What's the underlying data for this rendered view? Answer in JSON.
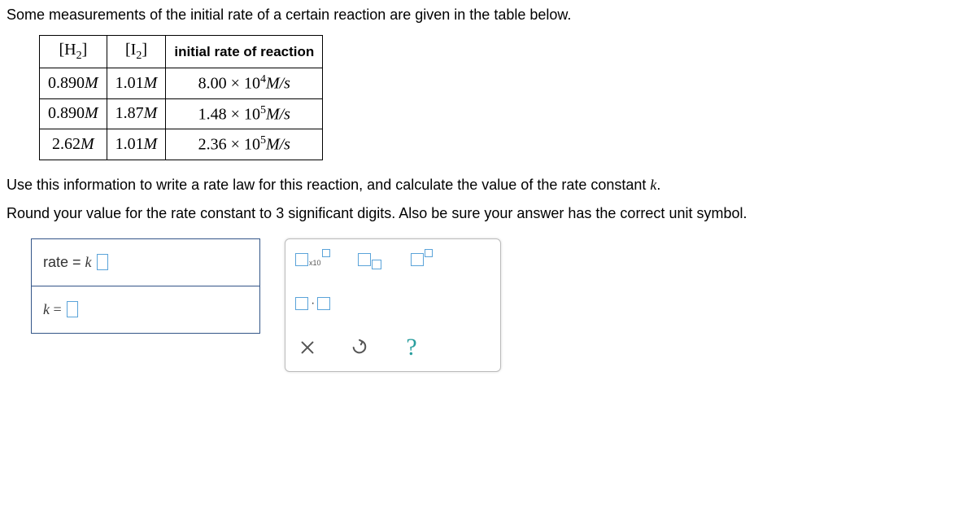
{
  "prompt": {
    "line1": "Some measurements of the initial rate of a certain reaction are given in the table below.",
    "line2_prefix": "Use this information to write a rate law for this reaction, and calculate the value of the rate constant ",
    "line2_var": "k",
    "line2_suffix": ".",
    "line3": "Round your value for the rate constant to 3 significant digits. Also be sure your answer has the correct unit symbol."
  },
  "table": {
    "headers": {
      "h2": "H",
      "h2_sub": "2",
      "i2": "I",
      "i2_sub": "2",
      "rate": "initial rate of reaction"
    },
    "rows": [
      {
        "h2": "0.890",
        "h2_u": "M",
        "i2": "1.01",
        "i2_u": "M",
        "rate_coef": "8.00 × 10",
        "rate_exp": "4",
        "rate_unit": "M/s"
      },
      {
        "h2": "0.890",
        "h2_u": "M",
        "i2": "1.87",
        "i2_u": "M",
        "rate_coef": "1.48 × 10",
        "rate_exp": "5",
        "rate_unit": "M/s"
      },
      {
        "h2": "2.62",
        "h2_u": "M",
        "i2": "1.01",
        "i2_u": "M",
        "rate_coef": "2.36 × 10",
        "rate_exp": "5",
        "rate_unit": "M/s"
      }
    ]
  },
  "answers": {
    "rate_label_prefix": "rate = ",
    "rate_label_var": "k",
    "k_label": "k ="
  },
  "tools": {
    "sci_label": "x10",
    "help": "?"
  }
}
